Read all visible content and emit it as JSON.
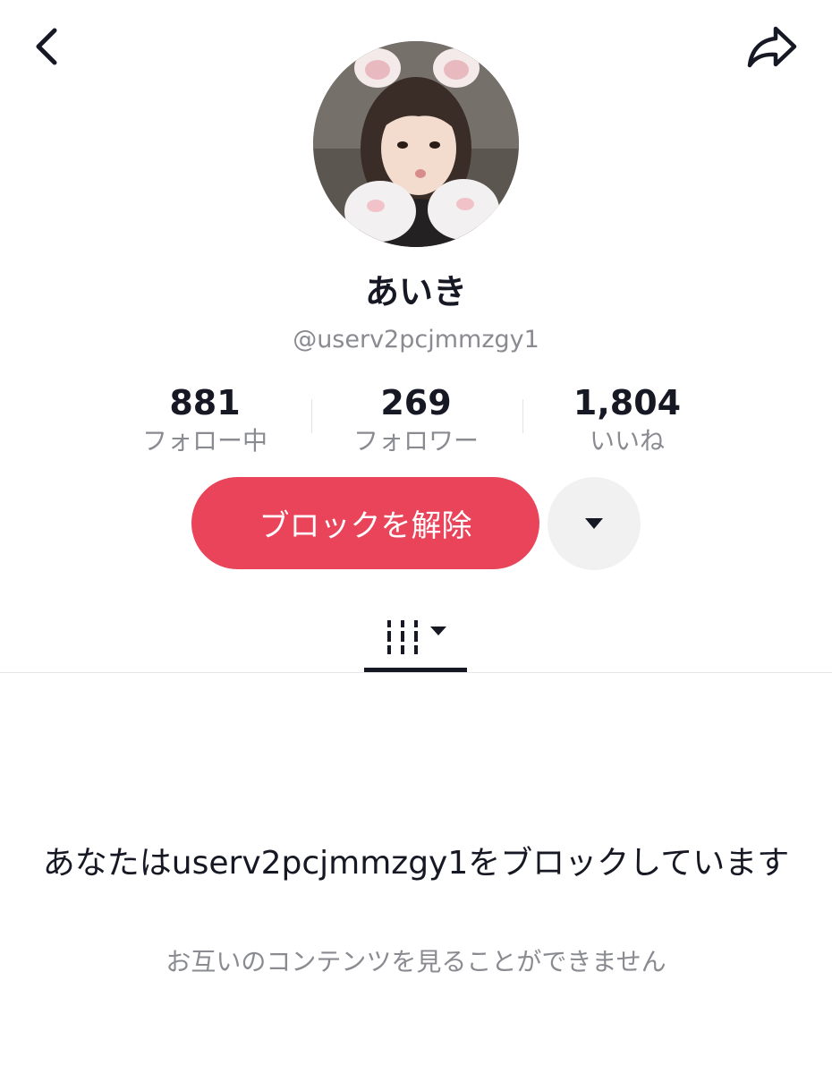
{
  "header": {
    "back_icon": "chevron-left-icon",
    "share_icon": "share-arrow-icon"
  },
  "profile": {
    "avatar": "avatar",
    "display_name": "あいき",
    "username": "@userv2pcjmmzgy1"
  },
  "stats": [
    {
      "value": "881",
      "label": "フォロー中"
    },
    {
      "value": "269",
      "label": "フォロワー"
    },
    {
      "value": "1,804",
      "label": "いいね"
    }
  ],
  "actions": {
    "unblock_label": "ブロックを解除",
    "more_icon": "caret-down-icon",
    "accent_color": "#ea445a"
  },
  "tabs": {
    "videos_icon": "grid-columns-icon",
    "dropdown_icon": "caret-down-icon"
  },
  "blocked": {
    "message": "あなたはuserv2pcjmmzgy1をブロックしています",
    "subtext": "お互いのコンテンツを見ることができません"
  }
}
